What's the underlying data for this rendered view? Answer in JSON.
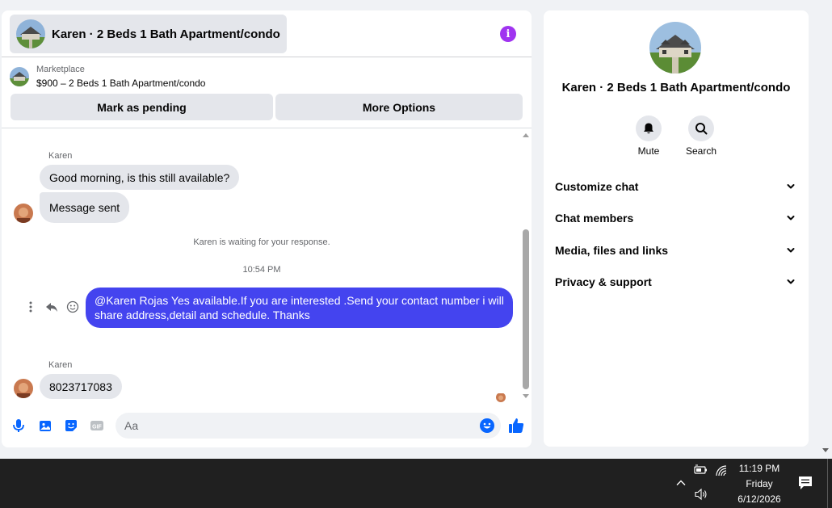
{
  "chat": {
    "header_title": "Karen · 2 Beds 1 Bath Apartment/condo",
    "listing": {
      "source": "Marketplace",
      "name": "$900 – 2 Beds 1 Bath Apartment/condo",
      "mark_pending_label": "Mark as pending",
      "more_options_label": "More Options"
    },
    "messages": {
      "sender_1": "Karen",
      "msg_1": "Good morning, is this still available?",
      "msg_2": "Message sent",
      "waiting_note": "Karen is waiting for your response.",
      "timestamp": "10:54 PM",
      "outgoing_line_1": "@Karen Rojas  Yes available.If you are interested .Send your contact number i will",
      "outgoing_line_2": "share address,detail and schedule. Thanks",
      "sender_2": "Karen",
      "msg_3": "8023717083"
    },
    "composer": {
      "placeholder": "Aa"
    }
  },
  "info_panel": {
    "title": "Karen · 2 Beds 1 Bath Apartment/condo",
    "actions": [
      {
        "label": "Mute",
        "icon": "bell-icon"
      },
      {
        "label": "Search",
        "icon": "search-icon"
      }
    ],
    "sections": [
      {
        "label": "Customize chat"
      },
      {
        "label": "Chat members"
      },
      {
        "label": "Media, files and links"
      },
      {
        "label": "Privacy & support"
      }
    ]
  },
  "taskbar": {
    "time": "11:19 PM",
    "day": "Friday",
    "date": "6/12/2026"
  },
  "colors": {
    "outgoing_bubble": "#4444ef",
    "accent_blue": "#0866ff",
    "info_purple": "#a034f0"
  }
}
